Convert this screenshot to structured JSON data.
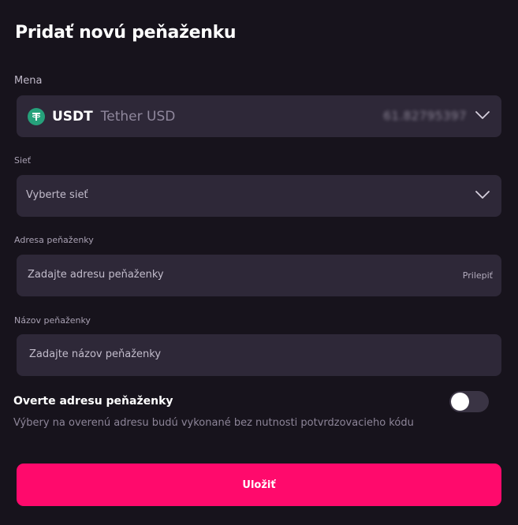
{
  "dialog": {
    "title": "Pridať novú peňaženku"
  },
  "currency": {
    "label": "Mena",
    "code": "USDT",
    "name": "Tether USD",
    "balance": "61.82795397",
    "icon": "tether-icon"
  },
  "network": {
    "label": "Sieť",
    "placeholder": "Vyberte sieť"
  },
  "address": {
    "label": "Adresa peňaženky",
    "placeholder": "Zadajte adresu peňaženky",
    "paste_label": "Prilepiť"
  },
  "wallet_name": {
    "label": "Názov peňaženky",
    "placeholder": "Zadajte názov peňaženky"
  },
  "verify": {
    "title": "Overte adresu peňaženky",
    "description": "Výbery na overenú adresu budú vykonané bez nutnosti potvrdzovacieho kódu",
    "enabled": false
  },
  "actions": {
    "save_label": "Uložiť"
  },
  "colors": {
    "accent": "#ff0a6c",
    "background": "#17131c",
    "field": "#2e2838",
    "tether": "#26a17b"
  }
}
